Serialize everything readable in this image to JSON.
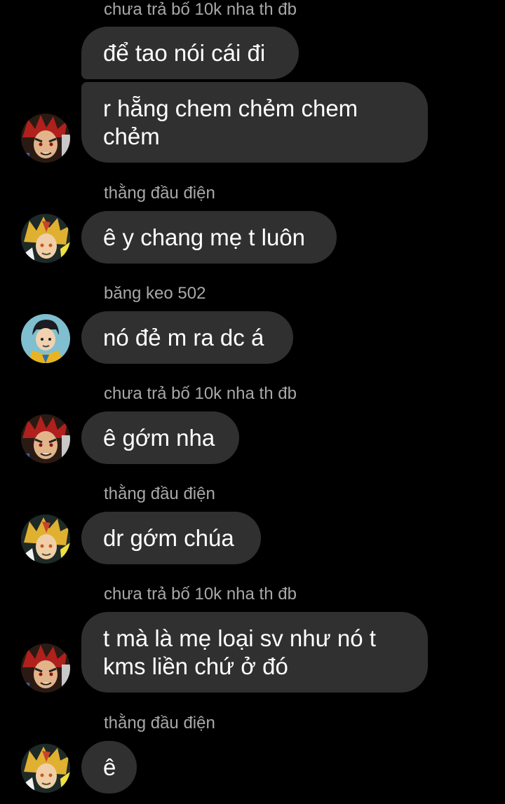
{
  "messages": [
    {
      "sender": "chưa trả bố 10k nha th đb",
      "text": "để tao nói cái đi"
    },
    {
      "text": "r hẵng chem chẻm chem chẻm"
    },
    {
      "sender": "thằng đầu điện",
      "text": "ê y chang mẹ t luôn"
    },
    {
      "sender": "băng keo 502",
      "text": "nó đẻ m ra dc á"
    },
    {
      "sender": "chưa trả bố 10k nha th đb",
      "text": "ê gớm nha"
    },
    {
      "sender": "thằng đầu điện",
      "text": "dr gớm chúa"
    },
    {
      "sender": "chưa trả bố 10k nha th đb",
      "text": "t mà là mẹ loại sv như nó t kms liền chứ ở đó"
    },
    {
      "sender": "thằng đầu điện",
      "text": "ê"
    }
  ],
  "avatars": [
    {
      "name": "red-hair-anime-avatar",
      "color": "#b0201c"
    },
    {
      "name": "blonde-anime-avatar",
      "color": "#e0b030"
    },
    {
      "name": "dark-hair-anime-avatar",
      "color": "#2f6fa8"
    }
  ],
  "colors": {
    "background": "#000000",
    "bubble": "#303030",
    "sender_text": "#a8a8a8",
    "message_text": "#ffffff"
  }
}
